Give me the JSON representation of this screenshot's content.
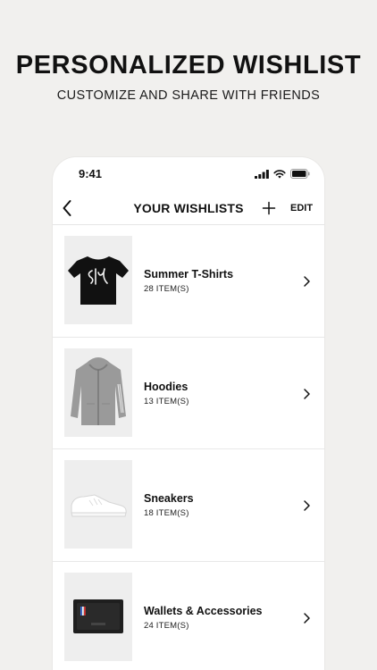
{
  "promo": {
    "headline": "PERSONALIZED WISHLIST",
    "subheadline": "CUSTOMIZE AND SHARE WITH FRIENDS"
  },
  "status_bar": {
    "time": "9:41",
    "icons": [
      "cellular-signal-icon",
      "wifi-icon",
      "battery-icon"
    ]
  },
  "navbar": {
    "back_icon": "chevron-left-icon",
    "title": "YOUR WISHLISTS",
    "add_icon": "plus-icon",
    "edit_label": "EDIT"
  },
  "wishlists": [
    {
      "name": "Summer T-Shirts",
      "count": "28 ITEM(S)",
      "thumbnail": "black-graphic-tshirt"
    },
    {
      "name": "Hoodies",
      "count": "13 ITEM(S)",
      "thumbnail": "grey-zip-hoodie"
    },
    {
      "name": "Sneakers",
      "count": "18 ITEM(S)",
      "thumbnail": "white-sneaker"
    },
    {
      "name": "Wallets & Accessories",
      "count": "24 ITEM(S)",
      "thumbnail": "black-card-holder"
    }
  ],
  "colors": {
    "background": "#f1f0ee",
    "card": "#ffffff",
    "text": "#111111",
    "thumb_bg": "#eeeeee"
  }
}
